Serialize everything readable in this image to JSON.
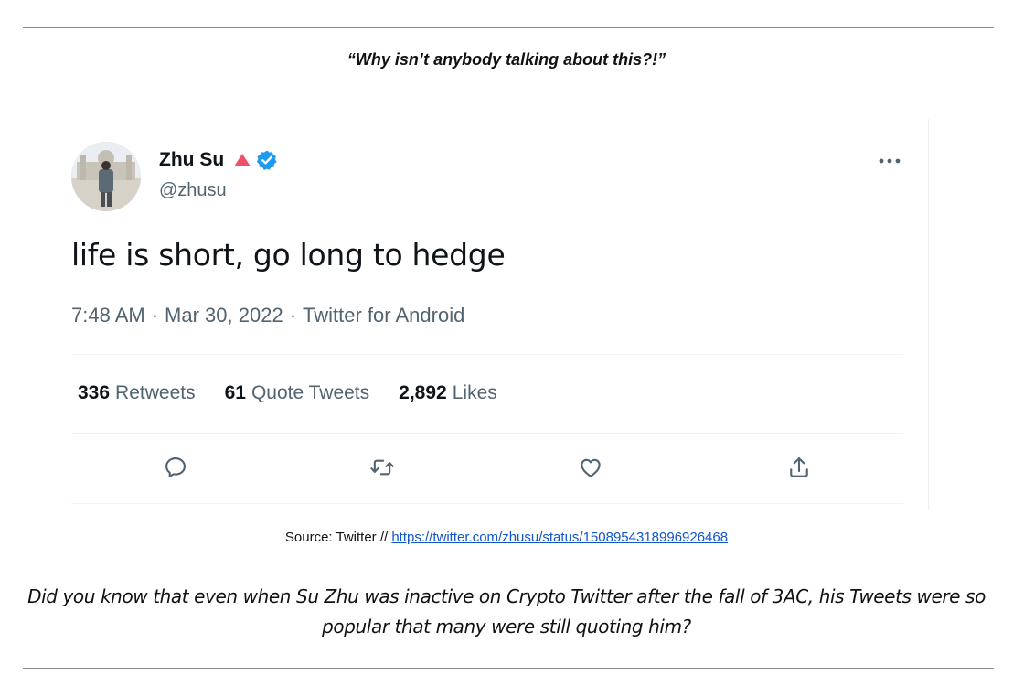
{
  "heading": "“Why isn’t anybody talking about this?!”",
  "tweet": {
    "author_name": "Zhu Su",
    "handle": "@zhusu",
    "text": "life is short, go long to hedge",
    "time": "7:48 AM",
    "date": "Mar 30, 2022",
    "source": "Twitter for Android",
    "separator": "·",
    "stats": [
      {
        "count": "336",
        "label": "Retweets"
      },
      {
        "count": "61",
        "label": "Quote Tweets"
      },
      {
        "count": "2,892",
        "label": "Likes"
      }
    ],
    "icons": {
      "more": "more-horizontal-icon",
      "reply": "reply-icon",
      "retweet": "retweet-icon",
      "like": "heart-icon",
      "share": "share-icon"
    },
    "colors": {
      "verified": "#1d9bf0",
      "triangle": "#f0506e",
      "secondary_text": "#536471"
    }
  },
  "source_line": {
    "prefix": "Source: Twitter // ",
    "url": "https://twitter.com/zhusu/status/1508954318996926468"
  },
  "caption": "Did you know that even when Su Zhu was inactive on Crypto Twitter after the fall of 3AC, his Tweets were so popular that many were still quoting him?"
}
